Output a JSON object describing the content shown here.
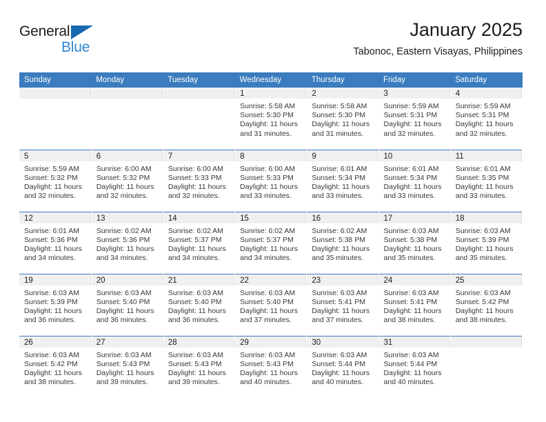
{
  "brand": {
    "name_top": "General",
    "name_bottom": "Blue",
    "triangle_color": "#1769b0",
    "blue_text_color": "#2f86d4"
  },
  "header": {
    "title": "January 2025",
    "subtitle": "Tabonoc, Eastern Visayas, Philippines"
  },
  "colors": {
    "header_row_bg": "#3a7cbe",
    "header_row_text": "#ffffff",
    "daynum_band_bg": "#f0f0f0",
    "row_divider": "#3a7cbe",
    "body_text": "#33373a"
  },
  "weekdays": [
    "Sunday",
    "Monday",
    "Tuesday",
    "Wednesday",
    "Thursday",
    "Friday",
    "Saturday"
  ],
  "labels": {
    "sunrise_prefix": "Sunrise:",
    "sunset_prefix": "Sunset:",
    "daylight_prefix": "Daylight:"
  },
  "weeks": [
    [
      {
        "day": "",
        "empty": true
      },
      {
        "day": "",
        "empty": true
      },
      {
        "day": "",
        "empty": true
      },
      {
        "day": "1",
        "sunrise": "Sunrise: 5:58 AM",
        "sunset": "Sunset: 5:30 PM",
        "daylight1": "Daylight: 11 hours",
        "daylight2": "and 31 minutes."
      },
      {
        "day": "2",
        "sunrise": "Sunrise: 5:58 AM",
        "sunset": "Sunset: 5:30 PM",
        "daylight1": "Daylight: 11 hours",
        "daylight2": "and 31 minutes."
      },
      {
        "day": "3",
        "sunrise": "Sunrise: 5:59 AM",
        "sunset": "Sunset: 5:31 PM",
        "daylight1": "Daylight: 11 hours",
        "daylight2": "and 32 minutes."
      },
      {
        "day": "4",
        "sunrise": "Sunrise: 5:59 AM",
        "sunset": "Sunset: 5:31 PM",
        "daylight1": "Daylight: 11 hours",
        "daylight2": "and 32 minutes."
      }
    ],
    [
      {
        "day": "5",
        "sunrise": "Sunrise: 5:59 AM",
        "sunset": "Sunset: 5:32 PM",
        "daylight1": "Daylight: 11 hours",
        "daylight2": "and 32 minutes."
      },
      {
        "day": "6",
        "sunrise": "Sunrise: 6:00 AM",
        "sunset": "Sunset: 5:32 PM",
        "daylight1": "Daylight: 11 hours",
        "daylight2": "and 32 minutes."
      },
      {
        "day": "7",
        "sunrise": "Sunrise: 6:00 AM",
        "sunset": "Sunset: 5:33 PM",
        "daylight1": "Daylight: 11 hours",
        "daylight2": "and 32 minutes."
      },
      {
        "day": "8",
        "sunrise": "Sunrise: 6:00 AM",
        "sunset": "Sunset: 5:33 PM",
        "daylight1": "Daylight: 11 hours",
        "daylight2": "and 33 minutes."
      },
      {
        "day": "9",
        "sunrise": "Sunrise: 6:01 AM",
        "sunset": "Sunset: 5:34 PM",
        "daylight1": "Daylight: 11 hours",
        "daylight2": "and 33 minutes."
      },
      {
        "day": "10",
        "sunrise": "Sunrise: 6:01 AM",
        "sunset": "Sunset: 5:34 PM",
        "daylight1": "Daylight: 11 hours",
        "daylight2": "and 33 minutes."
      },
      {
        "day": "11",
        "sunrise": "Sunrise: 6:01 AM",
        "sunset": "Sunset: 5:35 PM",
        "daylight1": "Daylight: 11 hours",
        "daylight2": "and 33 minutes."
      }
    ],
    [
      {
        "day": "12",
        "sunrise": "Sunrise: 6:01 AM",
        "sunset": "Sunset: 5:36 PM",
        "daylight1": "Daylight: 11 hours",
        "daylight2": "and 34 minutes."
      },
      {
        "day": "13",
        "sunrise": "Sunrise: 6:02 AM",
        "sunset": "Sunset: 5:36 PM",
        "daylight1": "Daylight: 11 hours",
        "daylight2": "and 34 minutes."
      },
      {
        "day": "14",
        "sunrise": "Sunrise: 6:02 AM",
        "sunset": "Sunset: 5:37 PM",
        "daylight1": "Daylight: 11 hours",
        "daylight2": "and 34 minutes."
      },
      {
        "day": "15",
        "sunrise": "Sunrise: 6:02 AM",
        "sunset": "Sunset: 5:37 PM",
        "daylight1": "Daylight: 11 hours",
        "daylight2": "and 34 minutes."
      },
      {
        "day": "16",
        "sunrise": "Sunrise: 6:02 AM",
        "sunset": "Sunset: 5:38 PM",
        "daylight1": "Daylight: 11 hours",
        "daylight2": "and 35 minutes."
      },
      {
        "day": "17",
        "sunrise": "Sunrise: 6:03 AM",
        "sunset": "Sunset: 5:38 PM",
        "daylight1": "Daylight: 11 hours",
        "daylight2": "and 35 minutes."
      },
      {
        "day": "18",
        "sunrise": "Sunrise: 6:03 AM",
        "sunset": "Sunset: 5:39 PM",
        "daylight1": "Daylight: 11 hours",
        "daylight2": "and 35 minutes."
      }
    ],
    [
      {
        "day": "19",
        "sunrise": "Sunrise: 6:03 AM",
        "sunset": "Sunset: 5:39 PM",
        "daylight1": "Daylight: 11 hours",
        "daylight2": "and 36 minutes."
      },
      {
        "day": "20",
        "sunrise": "Sunrise: 6:03 AM",
        "sunset": "Sunset: 5:40 PM",
        "daylight1": "Daylight: 11 hours",
        "daylight2": "and 36 minutes."
      },
      {
        "day": "21",
        "sunrise": "Sunrise: 6:03 AM",
        "sunset": "Sunset: 5:40 PM",
        "daylight1": "Daylight: 11 hours",
        "daylight2": "and 36 minutes."
      },
      {
        "day": "22",
        "sunrise": "Sunrise: 6:03 AM",
        "sunset": "Sunset: 5:40 PM",
        "daylight1": "Daylight: 11 hours",
        "daylight2": "and 37 minutes."
      },
      {
        "day": "23",
        "sunrise": "Sunrise: 6:03 AM",
        "sunset": "Sunset: 5:41 PM",
        "daylight1": "Daylight: 11 hours",
        "daylight2": "and 37 minutes."
      },
      {
        "day": "24",
        "sunrise": "Sunrise: 6:03 AM",
        "sunset": "Sunset: 5:41 PM",
        "daylight1": "Daylight: 11 hours",
        "daylight2": "and 38 minutes."
      },
      {
        "day": "25",
        "sunrise": "Sunrise: 6:03 AM",
        "sunset": "Sunset: 5:42 PM",
        "daylight1": "Daylight: 11 hours",
        "daylight2": "and 38 minutes."
      }
    ],
    [
      {
        "day": "26",
        "sunrise": "Sunrise: 6:03 AM",
        "sunset": "Sunset: 5:42 PM",
        "daylight1": "Daylight: 11 hours",
        "daylight2": "and 38 minutes."
      },
      {
        "day": "27",
        "sunrise": "Sunrise: 6:03 AM",
        "sunset": "Sunset: 5:43 PM",
        "daylight1": "Daylight: 11 hours",
        "daylight2": "and 39 minutes."
      },
      {
        "day": "28",
        "sunrise": "Sunrise: 6:03 AM",
        "sunset": "Sunset: 5:43 PM",
        "daylight1": "Daylight: 11 hours",
        "daylight2": "and 39 minutes."
      },
      {
        "day": "29",
        "sunrise": "Sunrise: 6:03 AM",
        "sunset": "Sunset: 5:43 PM",
        "daylight1": "Daylight: 11 hours",
        "daylight2": "and 40 minutes."
      },
      {
        "day": "30",
        "sunrise": "Sunrise: 6:03 AM",
        "sunset": "Sunset: 5:44 PM",
        "daylight1": "Daylight: 11 hours",
        "daylight2": "and 40 minutes."
      },
      {
        "day": "31",
        "sunrise": "Sunrise: 6:03 AM",
        "sunset": "Sunset: 5:44 PM",
        "daylight1": "Daylight: 11 hours",
        "daylight2": "and 40 minutes."
      },
      {
        "day": "",
        "empty": true
      }
    ]
  ]
}
